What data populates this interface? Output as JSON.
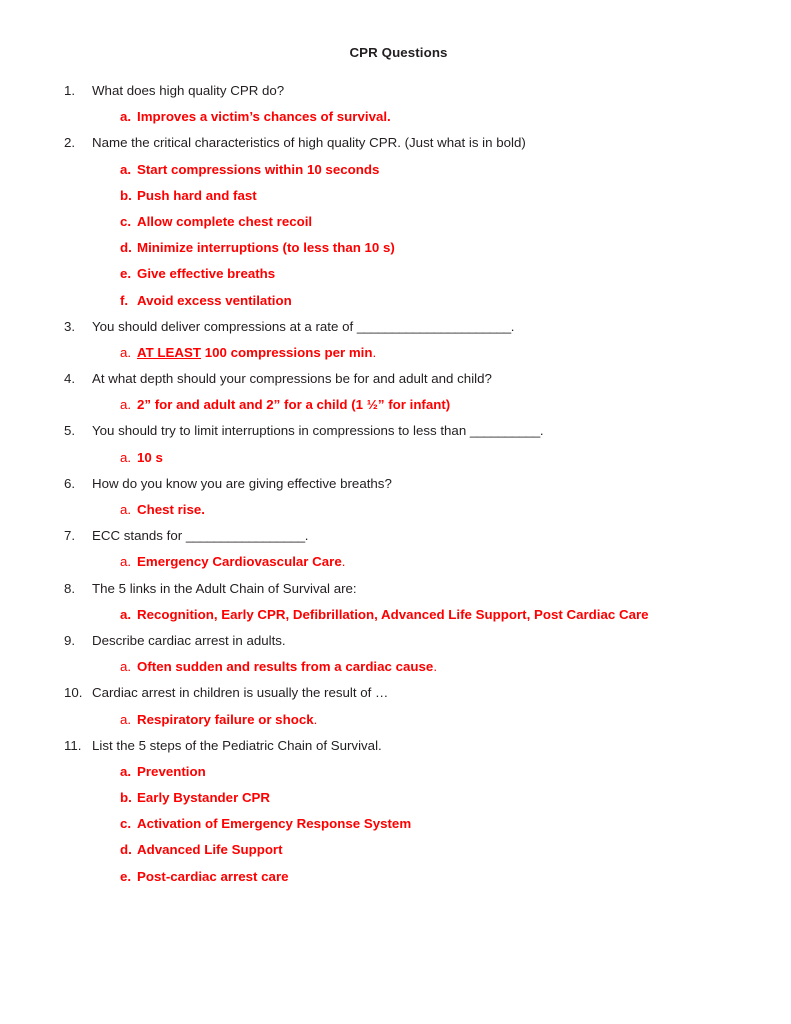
{
  "document": {
    "title": "CPR Questions",
    "accent_color": "#fe0000",
    "text_color": "#231f20",
    "background_color": "#ffffff"
  },
  "questions": [
    {
      "marker": "1.",
      "text": "What does high quality CPR do?",
      "answers": [
        {
          "marker": "a.",
          "marker_weight": "bold",
          "text": "Improves a victim’s chances of survival."
        }
      ]
    },
    {
      "marker": "2.",
      "text": "Name the critical characteristics of high quality CPR. (Just what is in bold)",
      "answers": [
        {
          "marker": "a.",
          "marker_weight": "bold",
          "text": "Start compressions within 10 seconds"
        },
        {
          "marker": "b.",
          "marker_weight": "bold",
          "text": "Push hard and fast"
        },
        {
          "marker": "c.",
          "marker_weight": "bold",
          "text": "Allow complete chest recoil"
        },
        {
          "marker": "d.",
          "marker_weight": "bold",
          "text": "Minimize interruptions (to less than 10 s)"
        },
        {
          "marker": "e.",
          "marker_weight": "bold",
          "text": "Give effective breaths"
        },
        {
          "marker": "f.",
          "marker_weight": "bold",
          "text": "Avoid excess ventilation"
        }
      ]
    },
    {
      "marker": "3.",
      "text": "You should deliver compressions at a rate of ",
      "blank": "______________________",
      "text_after": ".",
      "answers": [
        {
          "marker": "a.",
          "marker_weight": "thin",
          "underlined": "AT LEAST",
          "text": " 100 compressions per min",
          "text_after": "."
        }
      ]
    },
    {
      "marker": "4.",
      "text": "At what depth should your compressions be for and adult and child?",
      "answers": [
        {
          "marker": "a.",
          "marker_weight": "thin",
          "text": "2” for and adult and 2” for a child (1 ½” for infant)"
        }
      ]
    },
    {
      "marker": "5.",
      "text": "You should try to limit interruptions in compressions to less than ",
      "blank": "__________",
      "text_after": ".",
      "answers": [
        {
          "marker": "a.",
          "marker_weight": "thin",
          "text": "10 s"
        }
      ]
    },
    {
      "marker": "6.",
      "text": "How do you know you are giving effective breaths?",
      "answers": [
        {
          "marker": "a.",
          "marker_weight": "thin",
          "text": "Chest rise."
        }
      ]
    },
    {
      "marker": "7.",
      "text": "ECC stands for ",
      "blank": "_________________",
      "text_after": ".",
      "answers": [
        {
          "marker": "a.",
          "marker_weight": "thin",
          "text": "Emergency Cardiovascular Care",
          "text_after": "."
        }
      ]
    },
    {
      "marker": "8.",
      "text": "The 5 links in the Adult Chain of Survival are:",
      "answers": [
        {
          "marker": "a.",
          "marker_weight": "bold",
          "text": "Recognition, Early CPR, Defibrillation, Advanced Life Support, Post Cardiac Care"
        }
      ]
    },
    {
      "marker": "9.",
      "text": "Describe cardiac arrest in adults.",
      "answers": [
        {
          "marker": "a.",
          "marker_weight": "thin",
          "text": "Often sudden and results from a cardiac cause",
          "text_after": "."
        }
      ]
    },
    {
      "marker": "10.",
      "text": "Cardiac arrest in children is usually the result of …",
      "answers": [
        {
          "marker": "a.",
          "marker_weight": "thin",
          "text": "Respiratory failure or shock",
          "text_after": "."
        }
      ]
    },
    {
      "marker": "11.",
      "text": "List the 5 steps of the Pediatric Chain of Survival.",
      "answers": [
        {
          "marker": "a.",
          "marker_weight": "bold",
          "text": "Prevention"
        },
        {
          "marker": "b.",
          "marker_weight": "bold",
          "text": "Early Bystander CPR"
        },
        {
          "marker": "c.",
          "marker_weight": "bold",
          "text": "Activation of Emergency Response System"
        },
        {
          "marker": "d.",
          "marker_weight": "bold",
          "text": "Advanced Life Support"
        },
        {
          "marker": "e.",
          "marker_weight": "bold",
          "text": "Post-cardiac arrest care"
        }
      ]
    }
  ]
}
